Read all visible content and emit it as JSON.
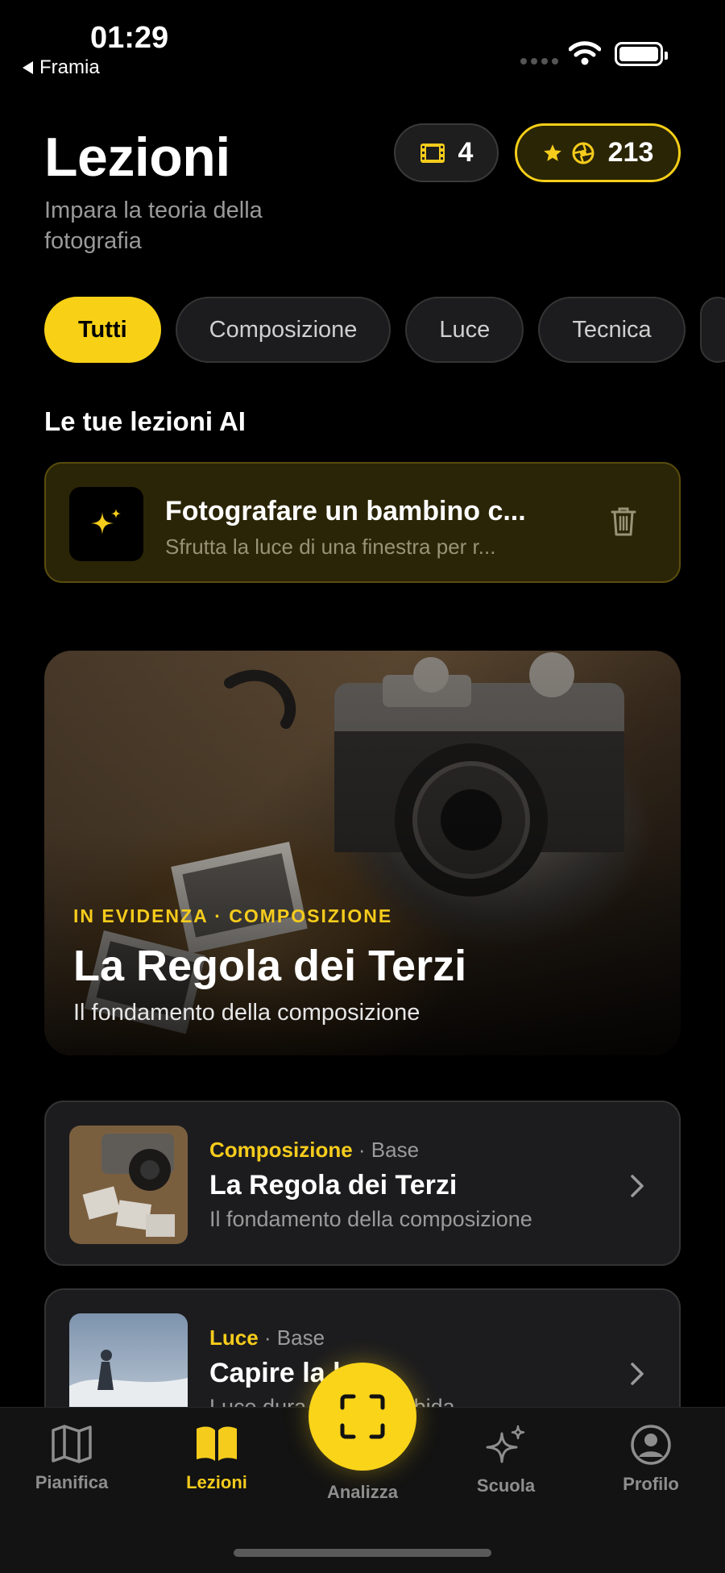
{
  "status_bar": {
    "time": "01:29",
    "back_label": "Framia"
  },
  "header": {
    "title": "Lezioni",
    "subtitle": "Impara la teoria della fotografia",
    "film_count": "4",
    "xp_count": "213"
  },
  "filters": [
    {
      "label": "Tutti",
      "active": true
    },
    {
      "label": "Composizione",
      "active": false
    },
    {
      "label": "Luce",
      "active": false
    },
    {
      "label": "Tecnica",
      "active": false
    }
  ],
  "ai_section": {
    "title": "Le tue lezioni AI",
    "card": {
      "title": "Fotografare un bambino c...",
      "description": "Sfrutta la luce di una finestra per r..."
    }
  },
  "featured": {
    "kicker": "IN EVIDENZA · COMPOSIZIONE",
    "title": "La Regola dei Terzi",
    "subtitle": "Il fondamento della composizione"
  },
  "lessons": [
    {
      "category": "Composizione",
      "level": "· Base",
      "title": "La Regola dei Terzi",
      "description": "Il fondamento della composizione"
    },
    {
      "category": "Luce",
      "level": "· Base",
      "title": "Capire la luce",
      "description": "Luce dura e luce morbida"
    }
  ],
  "tabbar": {
    "plan": "Pianifica",
    "lessons": "Lezioni",
    "analyze": "Analizza",
    "school": "Scuola",
    "profile": "Profilo"
  },
  "colors": {
    "accent": "#f8d117",
    "background": "#000000",
    "card": "#1c1c1e"
  }
}
